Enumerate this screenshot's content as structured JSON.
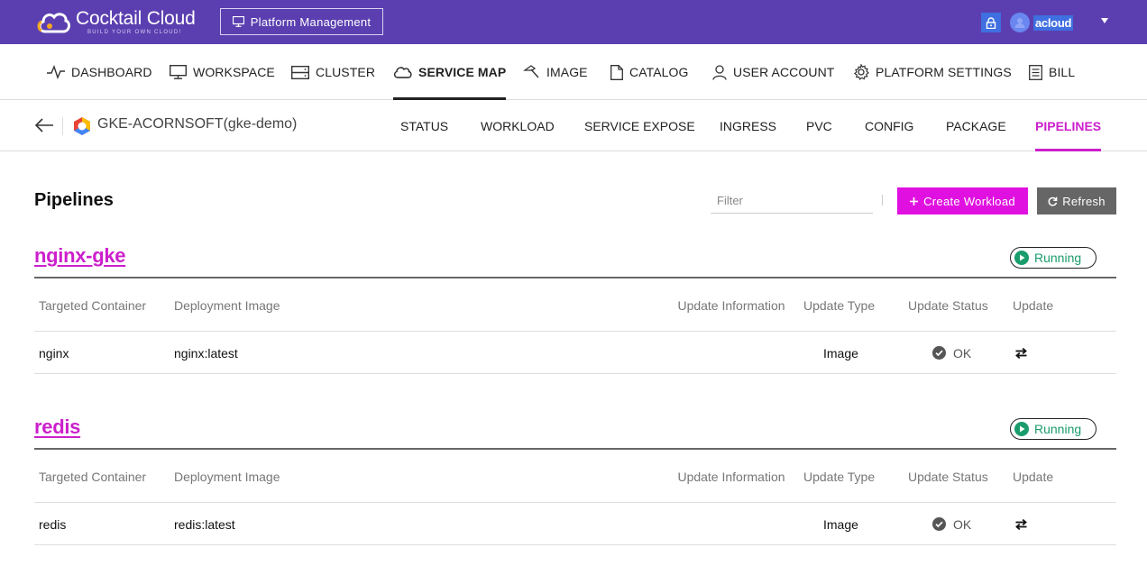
{
  "header": {
    "brand": "Cocktail Cloud",
    "brand_tagline": "BUILD YOUR OWN CLOUD!",
    "platform_button": "Platform Management",
    "username": "acloud"
  },
  "main_nav": [
    {
      "label": "DASHBOARD",
      "icon": "pulse-icon"
    },
    {
      "label": "WORKSPACE",
      "icon": "monitor-icon"
    },
    {
      "label": "CLUSTER",
      "icon": "server-icon"
    },
    {
      "label": "SERVICE MAP",
      "icon": "cloud-icon",
      "active": true
    },
    {
      "label": "IMAGE",
      "icon": "hammer-icon"
    },
    {
      "label": "CATALOG",
      "icon": "document-icon"
    },
    {
      "label": "USER ACCOUNT",
      "icon": "user-icon"
    },
    {
      "label": "PLATFORM SETTINGS",
      "icon": "gear-icon"
    },
    {
      "label": "BILL",
      "icon": "receipt-icon"
    }
  ],
  "sub_header": {
    "cluster_name": "GKE-ACORNSOFT(gke-demo)",
    "tabs": [
      {
        "label": "STATUS"
      },
      {
        "label": "WORKLOAD"
      },
      {
        "label": "SERVICE EXPOSE"
      },
      {
        "label": "INGRESS"
      },
      {
        "label": "PVC"
      },
      {
        "label": "CONFIG"
      },
      {
        "label": "PACKAGE"
      },
      {
        "label": "PIPELINES",
        "active": true
      }
    ]
  },
  "page": {
    "title": "Pipelines",
    "filter_placeholder": "Filter",
    "create_label": "Create Workload",
    "refresh_label": "Refresh"
  },
  "columns": {
    "targeted_container": "Targeted Container",
    "deployment_image": "Deployment Image",
    "update_information": "Update Information",
    "update_type": "Update Type",
    "update_status": "Update Status",
    "update": "Update"
  },
  "pipelines": [
    {
      "name": "nginx-gke",
      "status": "Running",
      "rows": [
        {
          "container": "nginx",
          "image": "nginx:latest",
          "update_info": "",
          "update_type": "Image",
          "update_status": "OK"
        }
      ]
    },
    {
      "name": "redis",
      "status": "Running",
      "rows": [
        {
          "container": "redis",
          "image": "redis:latest",
          "update_info": "",
          "update_type": "Image",
          "update_status": "OK"
        }
      ]
    }
  ],
  "colors": {
    "topbar": "#5b3fb0",
    "accent": "#e011e0",
    "running": "#1a9c6c"
  }
}
